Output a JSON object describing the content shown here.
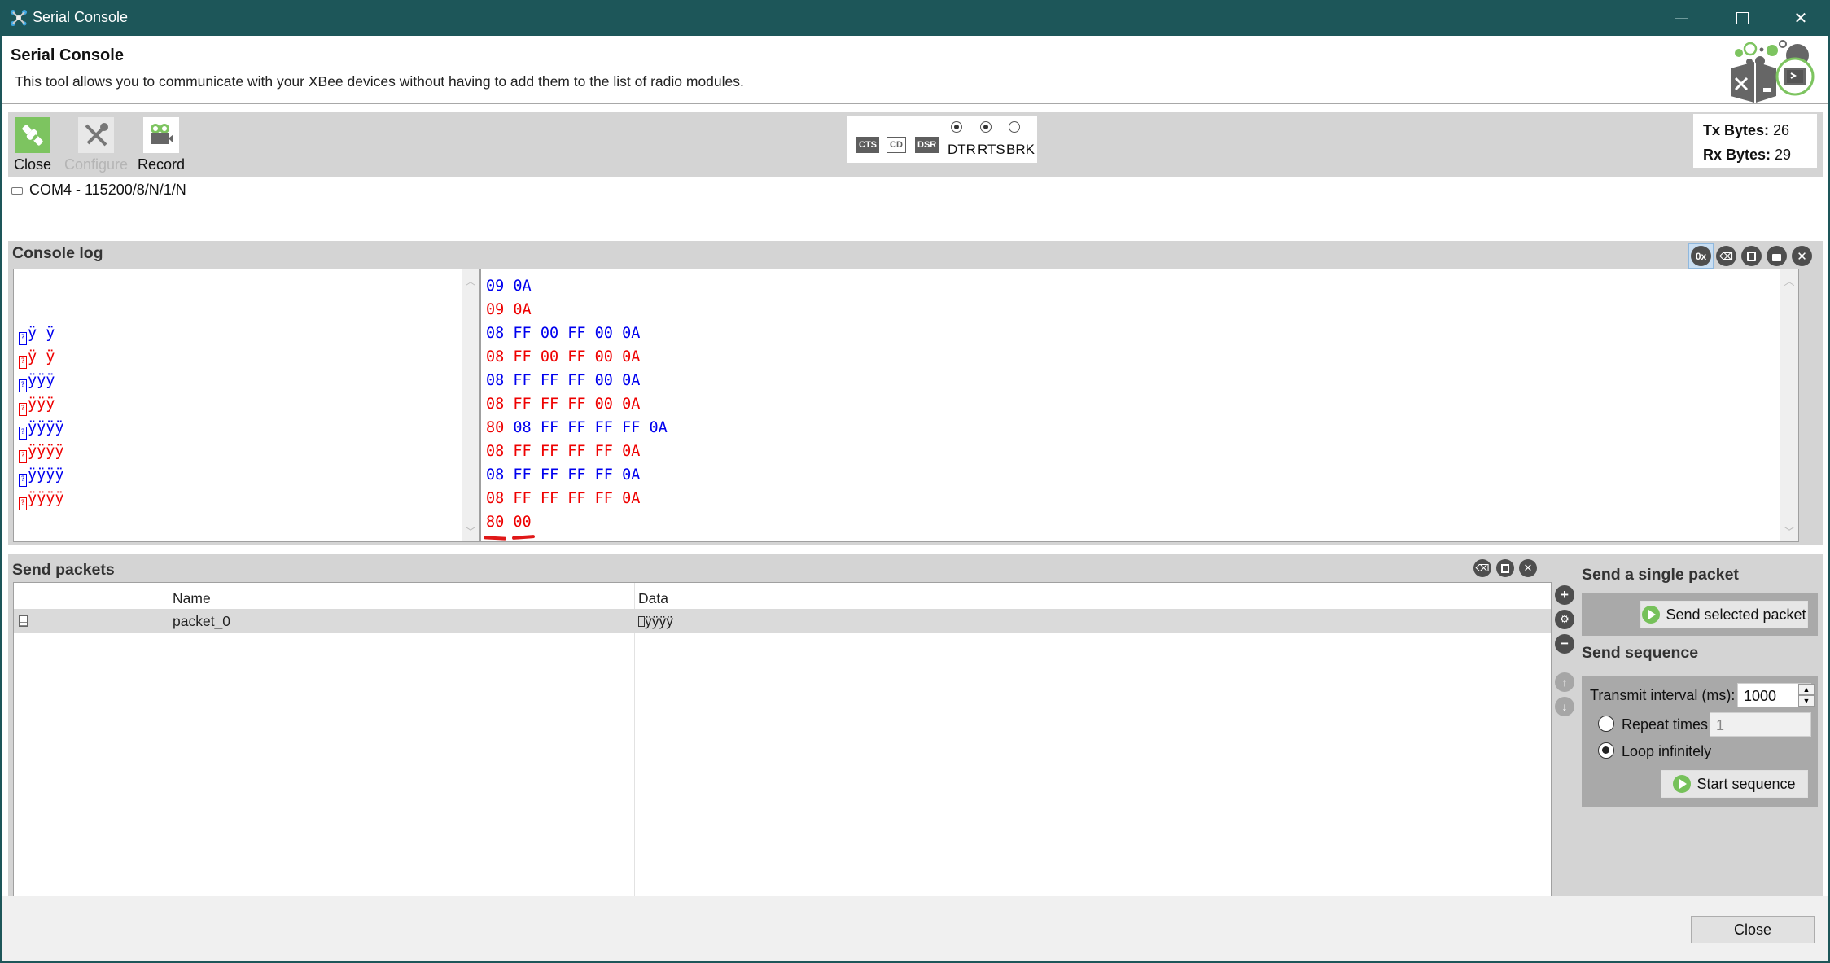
{
  "window": {
    "title": "Serial Console",
    "controls": {
      "minimize": "—",
      "maximize": "☐",
      "close": "✕"
    }
  },
  "header": {
    "title": "Serial Console",
    "description": "This tool allows you to communicate with your XBee devices without having to add them to the list of radio modules."
  },
  "toolbar": {
    "buttons": [
      {
        "label": "Close",
        "icon": "plug-disconnect-icon",
        "enabled": true
      },
      {
        "label": "Configure",
        "icon": "wrench-screwdriver-icon",
        "enabled": false
      },
      {
        "label": "Record",
        "icon": "video-camera-icon",
        "enabled": true
      }
    ],
    "line_status": {
      "pins": [
        {
          "label": "CTS",
          "active": true
        },
        {
          "label": "CD",
          "active": false
        },
        {
          "label": "DSR",
          "active": true
        }
      ],
      "controls": [
        {
          "label": "DTR",
          "checked": true
        },
        {
          "label": "RTS",
          "checked": true
        },
        {
          "label": "BRK",
          "checked": false
        }
      ]
    },
    "bytes": {
      "tx_label": "Tx Bytes:",
      "tx_value": "26",
      "rx_label": "Rx Bytes:",
      "rx_value": "29"
    }
  },
  "port": {
    "label": "COM4 - 115200/8/N/1/N",
    "icon": "serial-port-icon"
  },
  "console": {
    "title": "Console log",
    "actions": [
      {
        "name": "hex-toggle",
        "glyph": "0x",
        "active": true
      },
      {
        "name": "clear",
        "glyph": "⌫",
        "active": false
      },
      {
        "name": "save",
        "glyph": "💾",
        "active": false
      },
      {
        "name": "lock",
        "glyph": "🔒",
        "active": false
      },
      {
        "name": "close",
        "glyph": "✕",
        "active": false
      }
    ],
    "tx_color": "#0000ee",
    "rx_color": "#ee0000",
    "ascii_lines": [
      {
        "dir": "tx",
        "text": ""
      },
      {
        "dir": "rx",
        "text": ""
      },
      {
        "dir": "tx",
        "text": "ÿ ÿ",
        "badchar": true
      },
      {
        "dir": "rx",
        "text": "ÿ ÿ",
        "badchar": true
      },
      {
        "dir": "tx",
        "text": "ÿÿÿ",
        "badchar": true
      },
      {
        "dir": "rx",
        "text": "ÿÿÿ",
        "badchar": true
      },
      {
        "dir": "tx",
        "text": "ÿÿÿÿ",
        "badchar": true
      },
      {
        "dir": "rx",
        "text": "ÿÿÿÿ",
        "badchar": true
      },
      {
        "dir": "tx",
        "text": "ÿÿÿÿ",
        "badchar": true
      },
      {
        "dir": "rx",
        "text": "ÿÿÿÿ",
        "badchar": true
      }
    ],
    "hex_lines": [
      {
        "segments": [
          {
            "dir": "tx",
            "text": "09 0A"
          }
        ]
      },
      {
        "segments": [
          {
            "dir": "rx",
            "text": "09 0A"
          }
        ]
      },
      {
        "segments": [
          {
            "dir": "tx",
            "text": "08 FF 00 FF 00 0A"
          }
        ]
      },
      {
        "segments": [
          {
            "dir": "rx",
            "text": "08 FF 00 FF 00 0A"
          }
        ]
      },
      {
        "segments": [
          {
            "dir": "tx",
            "text": "08 FF FF FF 00 0A"
          }
        ]
      },
      {
        "segments": [
          {
            "dir": "rx",
            "text": "08 FF FF FF 00 0A"
          }
        ]
      },
      {
        "segments": [
          {
            "dir": "rx",
            "text": "80 "
          },
          {
            "dir": "tx",
            "text": "08 FF FF FF FF 0A"
          }
        ]
      },
      {
        "segments": [
          {
            "dir": "rx",
            "text": "08 FF FF FF FF 0A"
          }
        ]
      },
      {
        "segments": [
          {
            "dir": "tx",
            "text": "08 FF FF FF FF 0A"
          }
        ]
      },
      {
        "segments": [
          {
            "dir": "rx",
            "text": "08 FF FF FF FF 0A"
          }
        ]
      },
      {
        "segments": [
          {
            "dir": "rx",
            "text": "80 00"
          }
        ]
      }
    ]
  },
  "send_packets": {
    "title": "Send packets",
    "actions": [
      "clear",
      "save",
      "close"
    ],
    "columns": [
      "",
      "Name",
      "Data"
    ],
    "rows": [
      {
        "icon": "document-icon",
        "name": "packet_0",
        "data": "ÿÿÿÿ",
        "selected": true
      }
    ],
    "side_actions": [
      {
        "name": "add",
        "glyph": "+",
        "enabled": true
      },
      {
        "name": "edit",
        "glyph": "⚙",
        "enabled": true
      },
      {
        "name": "remove",
        "glyph": "−",
        "enabled": true
      },
      {
        "name": "move-up",
        "glyph": "↑",
        "enabled": false
      },
      {
        "name": "move-down",
        "glyph": "↓",
        "enabled": false
      }
    ]
  },
  "single_packet": {
    "title": "Send a single packet",
    "button": "Send selected packet"
  },
  "sequence": {
    "title": "Send sequence",
    "interval_label": "Transmit interval (ms):",
    "interval_value": "1000",
    "repeat_label": "Repeat times",
    "repeat_value": "1",
    "repeat_selected": false,
    "loop_label": "Loop infinitely",
    "loop_selected": true,
    "start_button": "Start sequence"
  },
  "footer": {
    "close_button": "Close"
  }
}
